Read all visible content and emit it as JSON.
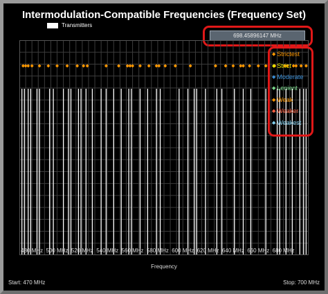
{
  "title": "Intermodulation-Compatible Frequencies (Frequency Set)",
  "readout": "698.45896147 MHz",
  "footer": {
    "start": "Start: 470 MHz",
    "stop": "Stop: 700 MHz"
  },
  "colors": {
    "transmitters": "#ffffff",
    "highlight": "#e01818",
    "dots": "#ff9900"
  },
  "chart_data": {
    "type": "scatter",
    "xlabel": "Frequency",
    "xlim": [
      470,
      700
    ],
    "x_ticks": [
      "480 MHz",
      "500 MHz",
      "520 MHz",
      "540 MHz",
      "560 MHz",
      "580 MHz",
      "600 MHz",
      "620 MHz",
      "640 MHz",
      "660 MHz",
      "680 MHz"
    ],
    "x_tick_values": [
      480,
      500,
      520,
      540,
      560,
      580,
      600,
      620,
      640,
      660,
      680
    ],
    "grid": true,
    "series": [
      {
        "name": "Transmitters",
        "kind": "vertical-lines",
        "x": [
          472,
          474,
          477,
          479,
          484,
          486,
          494,
          497,
          505,
          509,
          511,
          517,
          519,
          523,
          528,
          535,
          539,
          545,
          551,
          557,
          559,
          566,
          572,
          579,
          582,
          597,
          604,
          609,
          611,
          618,
          627,
          631,
          641,
          648,
          654,
          666,
          675,
          677,
          682,
          687,
          693,
          696,
          698
        ]
      },
      {
        "name": "Strictest",
        "color": "#ff9900",
        "x": [
          473,
          475,
          477,
          480,
          486,
          493,
          500,
          508,
          516,
          521,
          524,
          539,
          549,
          556,
          558,
          560,
          566,
          573,
          579,
          581,
          586,
          594,
          606,
          626,
          634,
          640,
          646,
          648,
          653,
          660,
          666,
          673,
          681,
          683,
          688,
          690,
          694,
          698
        ]
      }
    ],
    "legend": {
      "placement": "right",
      "entries": [
        {
          "label": "Strictest",
          "color": "#ff9900"
        },
        {
          "label": "Strict",
          "color": "#e8e800"
        },
        {
          "label": "Moderate",
          "color": "#3a8fd8"
        },
        {
          "label": "Lenient",
          "color": "#7adc8c"
        },
        {
          "label": "Weak",
          "color": "#ff9900"
        },
        {
          "label": "Weaker",
          "color": "#ff6040"
        },
        {
          "label": "Weakest",
          "color": "#80d0f0"
        }
      ]
    }
  }
}
